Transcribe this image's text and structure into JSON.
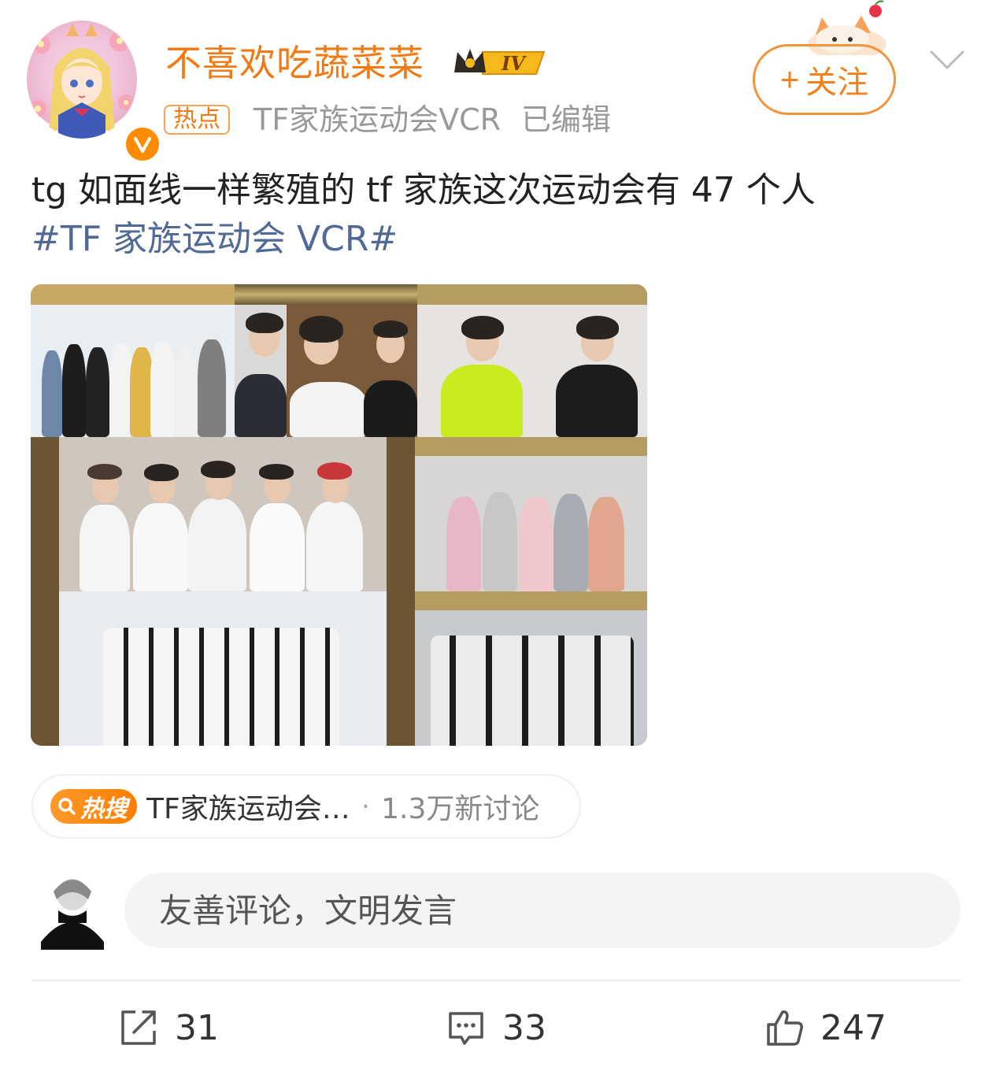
{
  "header": {
    "username": "不喜欢吃蔬菜菜",
    "level": "IV",
    "hot_tag": "热点",
    "topic": "TF家族运动会VCR",
    "edited": "已编辑",
    "follow_label": "关注",
    "follow_icon": "+"
  },
  "post": {
    "text": "tg 如面线一样繁殖的 tf 家族这次运动会有 47 个人",
    "hashtag": "#TF 家族运动会 VCR#"
  },
  "hot_search": {
    "badge": "热搜",
    "topic": "TF家族运动会…",
    "separator": "·",
    "count": "1.3万新讨论"
  },
  "comment": {
    "placeholder": "友善评论，文明发言"
  },
  "actions": {
    "repost_count": "31",
    "comment_count": "33",
    "like_count": "247"
  },
  "colors": {
    "brand_orange": "#f07b16",
    "link_blue": "#506a95",
    "muted": "#999999"
  }
}
